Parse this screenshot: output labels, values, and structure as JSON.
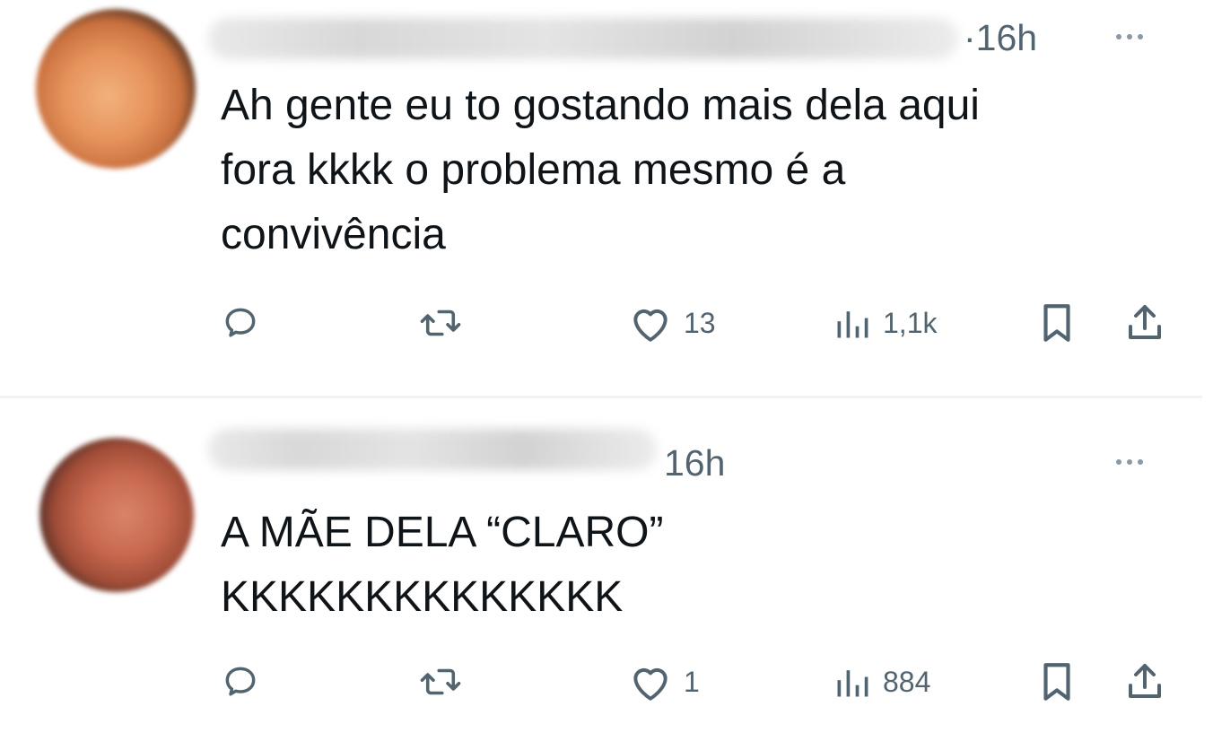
{
  "posts": [
    {
      "time": "·16h",
      "text_lines": [
        "Ah gente eu to gostando mais dela aqui",
        "fora kkkk o problema mesmo é a",
        "convivência"
      ],
      "likes": "13",
      "views": "1,1k"
    },
    {
      "time": "16h",
      "text_lines": [
        "A MÃE DELA “CLARO”",
        "KKKKKKKKKKKKKK"
      ],
      "likes": "1",
      "views": "884"
    }
  ],
  "icons": {
    "reply": "reply-icon",
    "retweet": "retweet-icon",
    "like": "heart-icon",
    "views": "views-icon",
    "bookmark": "bookmark-icon",
    "share": "share-icon",
    "more": "more-icon"
  },
  "colors": {
    "text": "#0f1419",
    "secondary": "#536471",
    "divider": "#eff3f4"
  }
}
